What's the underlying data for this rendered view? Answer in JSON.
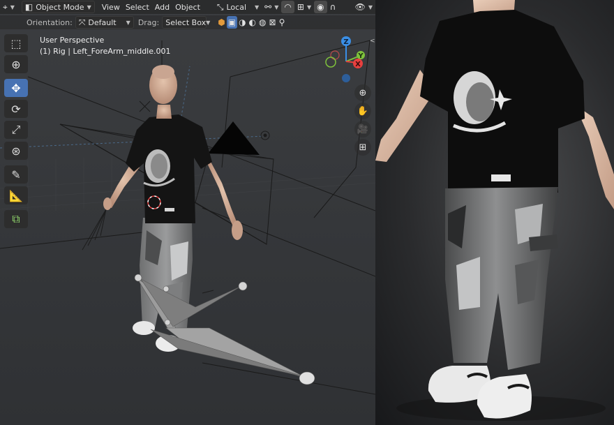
{
  "header": {
    "editor_icon": "view3d-icon",
    "mode_label": "Object Mode",
    "menus": [
      "View",
      "Select",
      "Add",
      "Object"
    ],
    "transform_space": "Local",
    "orientation_label": "Orientation:",
    "orientation_value": "Default",
    "drag_label": "Drag:",
    "drag_value": "Select Box"
  },
  "toolbar": {
    "tools": [
      {
        "name": "select-box-tool",
        "icon": "select-icon",
        "active": false
      },
      {
        "name": "cursor-tool",
        "icon": "cursor-icon",
        "active": false
      },
      {
        "name": "move-tool",
        "icon": "move-icon",
        "active": true
      },
      {
        "name": "rotate-tool",
        "icon": "rotate-icon",
        "active": false
      },
      {
        "name": "scale-tool",
        "icon": "scale-icon",
        "active": false
      },
      {
        "name": "transform-tool",
        "icon": "transform-icon",
        "active": false
      },
      {
        "name": "annotate-tool",
        "icon": "annotate-icon",
        "active": false
      },
      {
        "name": "measure-tool",
        "icon": "measure-icon",
        "active": false
      },
      {
        "name": "add-cube-tool",
        "icon": "add-cube-icon",
        "active": false
      }
    ]
  },
  "viewport": {
    "perspective": "User Perspective",
    "object_info": "(1) Rig | Left_ForeArm_middle.001"
  },
  "gizmo": {
    "z": "Z",
    "y": "Y",
    "x": "X"
  },
  "colors": {
    "accent": "#4772b3",
    "axis_x": "#e8403f",
    "axis_y": "#7fc23c",
    "axis_z": "#3a8fe6"
  }
}
